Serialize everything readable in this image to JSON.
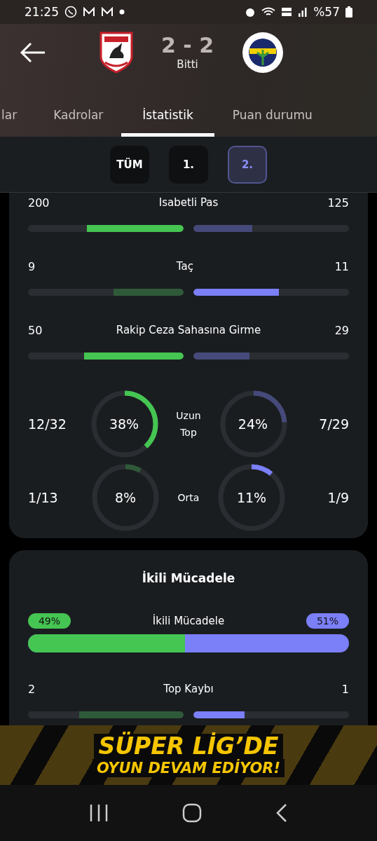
{
  "status_bar": {
    "time": "21:25",
    "battery": "%57"
  },
  "header": {
    "score": "2 - 2",
    "match_status": "Bitti"
  },
  "tabs": [
    {
      "label": "lar",
      "selected": false
    },
    {
      "label": "Kadrolar",
      "selected": false
    },
    {
      "label": "İstatistik",
      "selected": true
    },
    {
      "label": "Puan durumu",
      "selected": false
    }
  ],
  "periods": [
    {
      "label": "TÜM",
      "selected": false
    },
    {
      "label": "1.",
      "selected": false
    },
    {
      "label": "2.",
      "selected": true
    }
  ],
  "stats": [
    {
      "label": "Isabetli Pas",
      "home": {
        "value": "200",
        "level": 0.62,
        "highlighted": true
      },
      "away": {
        "value": "125",
        "level": 0.38,
        "highlighted": false
      }
    },
    {
      "label": "Taç",
      "home": {
        "value": "9",
        "level": 0.45,
        "highlighted": false
      },
      "away": {
        "value": "11",
        "level": 0.55,
        "highlighted": true
      }
    },
    {
      "label": "Rakip Ceza Sahasına Girme",
      "home": {
        "value": "50",
        "level": 0.64,
        "highlighted": true
      },
      "away": {
        "value": "29",
        "level": 0.36,
        "highlighted": false
      }
    }
  ],
  "ring_stats": [
    {
      "label": "Uzun Top",
      "home": {
        "count": "12/32",
        "percent": "38%",
        "level": 0.38,
        "highlighted": true
      },
      "away": {
        "count": "7/29",
        "percent": "24%",
        "level": 0.24,
        "highlighted": false
      }
    },
    {
      "label": "Orta",
      "home": {
        "count": "1/13",
        "percent": "8%",
        "level": 0.08,
        "highlighted": false
      },
      "away": {
        "count": "1/9",
        "percent": "11%",
        "level": 0.11,
        "highlighted": true
      }
    }
  ],
  "duels": {
    "title": "İkili Mücadele",
    "label": "İkili Mücadele",
    "home_percent": "49%",
    "away_percent": "51%",
    "level": 0.49,
    "stats": [
      {
        "label": "Top Kaybı",
        "home": {
          "value": "2",
          "level": 0.67,
          "highlighted": false
        },
        "away": {
          "value": "1",
          "level": 0.33,
          "highlighted": true
        }
      }
    ]
  },
  "banner": {
    "line_1": "SÜPER LİG’DE",
    "line_2": "OYUN DEVAM EDİYOR!"
  }
}
